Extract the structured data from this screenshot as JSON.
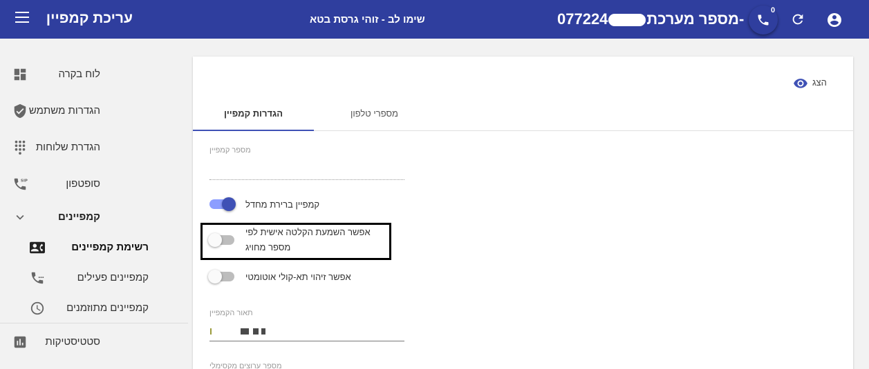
{
  "header": {
    "title": "עריכת קמפיין",
    "account_name": "שימו לב - זוהי גרסת בטא",
    "system_number_label": "מספר מערכת-",
    "system_number_value": "077224",
    "phone_badge": "0",
    "bar_color": "#2f3e9e",
    "icons": [
      "menu-icon",
      "phone-icon",
      "refresh-icon",
      "account-circle-icon"
    ]
  },
  "sidebar": {
    "items": [
      {
        "label": "לוח בקרה",
        "icon": "dashboard-icon"
      },
      {
        "label": "הגדרות משתמש",
        "icon": "shield-check-icon"
      },
      {
        "label": "הגדרת שלוחות",
        "icon": "dialpad-icon"
      },
      {
        "label": "סופטפון",
        "icon": "sip-phone-icon"
      },
      {
        "label": "קמפיינים",
        "icon": "chevron-down-icon"
      },
      {
        "label": "רשימת קמפיינים",
        "icon": "contact-card-icon"
      },
      {
        "label": "קמפיינים פעילים",
        "icon": "phone-in-talk-icon"
      },
      {
        "label": "קמפיינים מתוזמנים",
        "icon": "clock-icon"
      },
      {
        "label": "סטטיסטיקות",
        "icon": "bar-chart-icon"
      }
    ]
  },
  "card": {
    "show_label": "הצג",
    "tabs": [
      {
        "label": "מספרי טלפון"
      },
      {
        "label": "הגדרות קמפיין"
      }
    ],
    "fields": {
      "campaign_number_label": "מספר קמפיין",
      "campaign_number_value": "",
      "description_label": "תאור הקמפיין",
      "max_attempts_label": "מספר ערוצים מקסימלי"
    },
    "toggles": [
      {
        "label": "קמפיין ברירת מחדל",
        "on": true
      },
      {
        "label_line1": "אפשר השמעת הקלטה אישית לפי",
        "label_line2": "מספר מחויג",
        "on": false
      },
      {
        "label": "אפשר זיהוי תא-קולי אוטומטי",
        "on": false
      }
    ],
    "accent": "#3f51b5"
  }
}
